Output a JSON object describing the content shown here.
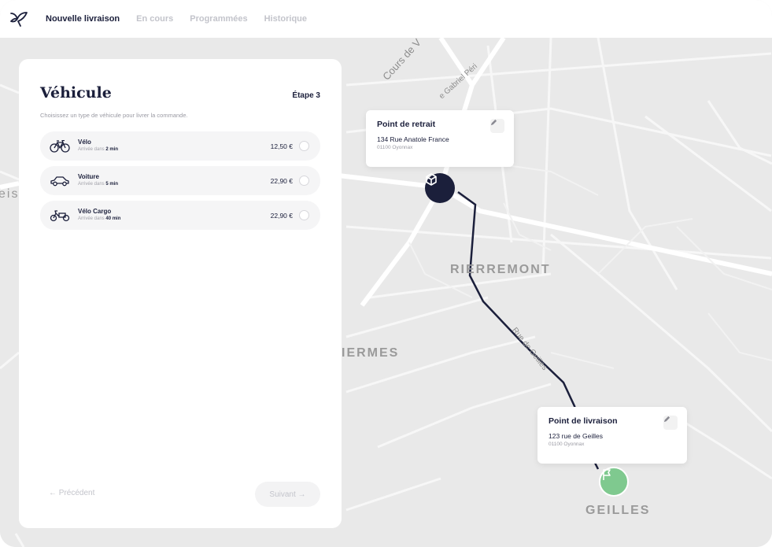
{
  "nav": {
    "logo": "bird-logo",
    "tabs": [
      {
        "label": "Nouvelle livraison",
        "active": true
      },
      {
        "label": "En cours",
        "active": false
      },
      {
        "label": "Programmées",
        "active": false
      },
      {
        "label": "Historique",
        "active": false
      }
    ]
  },
  "panel": {
    "title": "Véhicule",
    "step": "Étape 3",
    "subtitle": "Choisissez un type de véhicule pour livrer la commande.",
    "options": [
      {
        "name": "Vélo",
        "eta_prefix": "Arrivée dans",
        "eta": "2 min",
        "price": "12,50 €",
        "icon": "bicycle-icon",
        "selected": false
      },
      {
        "name": "Voiture",
        "eta_prefix": "Arrivée dans",
        "eta": "5 min",
        "price": "22,90 €",
        "icon": "car-icon",
        "selected": false
      },
      {
        "name": "Vélo Cargo",
        "eta_prefix": "Arrivée dans",
        "eta": "40 min",
        "price": "22,90 €",
        "icon": "cargo-bike-icon",
        "selected": false
      }
    ],
    "prev_label": "← Précédent",
    "next_label": "Suivant →"
  },
  "map": {
    "pickup": {
      "title": "Point de retrait",
      "address": "134 Rue Anatole France",
      "city": "01100 Oyonnax"
    },
    "dropoff": {
      "title": "Point de livraison",
      "address": "123 rue de Geilles",
      "city": "01100 Oyonnax"
    },
    "place_labels": {
      "bouvent": "eis",
      "pierremont": "RIERREMONT",
      "nermes": "IERMES",
      "geilles": "GEILLES"
    },
    "road_labels": {
      "cours": "Cours de V",
      "peri": "e Gabriel Péri",
      "geilles_road": "Rue de Geilles"
    }
  },
  "colors": {
    "primary": "#1b1f3b",
    "accent_green": "#7fc98f",
    "muted": "#c3c4cb"
  }
}
